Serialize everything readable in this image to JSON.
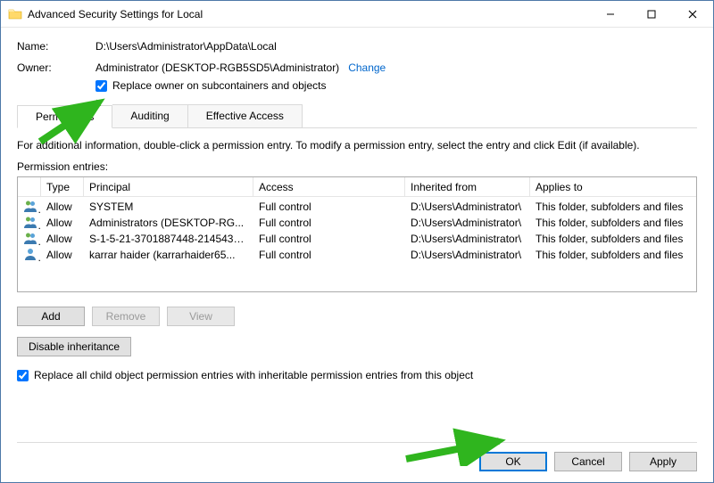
{
  "titlebar": {
    "title": "Advanced Security Settings for Local"
  },
  "fields": {
    "name_label": "Name:",
    "name_value": "D:\\Users\\Administrator\\AppData\\Local",
    "owner_label": "Owner:",
    "owner_value": "Administrator (DESKTOP-RGB5SD5\\Administrator)",
    "change_link": "Change",
    "replace_owner_label": "Replace owner on subcontainers and objects"
  },
  "tabs": {
    "permissions": "Permissions",
    "auditing": "Auditing",
    "effective": "Effective Access"
  },
  "info_text": "For additional information, double-click a permission entry. To modify a permission entry, select the entry and click Edit (if available).",
  "pe_label": "Permission entries:",
  "columns": {
    "type": "Type",
    "principal": "Principal",
    "access": "Access",
    "inherited": "Inherited from",
    "applies": "Applies to"
  },
  "entries": [
    {
      "type": "Allow",
      "principal": "SYSTEM",
      "access": "Full control",
      "inherited": "D:\\Users\\Administrator\\",
      "applies": "This folder, subfolders and files"
    },
    {
      "type": "Allow",
      "principal": "Administrators (DESKTOP-RG...",
      "access": "Full control",
      "inherited": "D:\\Users\\Administrator\\",
      "applies": "This folder, subfolders and files"
    },
    {
      "type": "Allow",
      "principal": "S-1-5-21-3701887448-2145437...",
      "access": "Full control",
      "inherited": "D:\\Users\\Administrator\\",
      "applies": "This folder, subfolders and files"
    },
    {
      "type": "Allow",
      "principal": "karrar haider (karrarhaider65...",
      "access": "Full control",
      "inherited": "D:\\Users\\Administrator\\",
      "applies": "This folder, subfolders and files"
    }
  ],
  "buttons": {
    "add": "Add",
    "remove": "Remove",
    "view": "View",
    "disable": "Disable inheritance",
    "ok": "OK",
    "cancel": "Cancel",
    "apply": "Apply"
  },
  "replace_all_label": "Replace all child object permission entries with inheritable permission entries from this object"
}
